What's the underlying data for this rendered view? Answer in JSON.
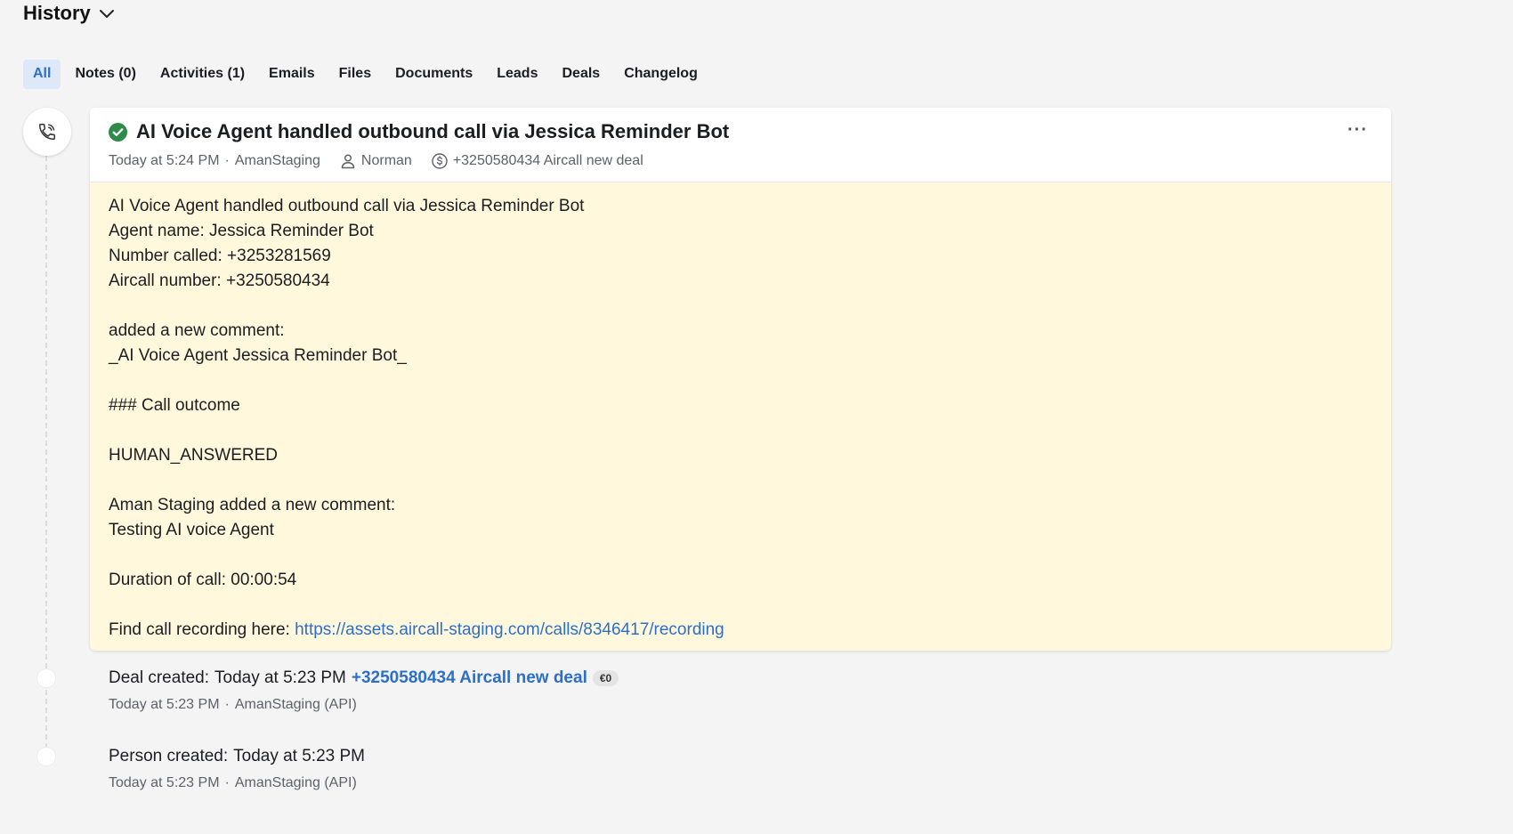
{
  "header": {
    "title": "History"
  },
  "tabs": [
    {
      "label": "All",
      "active": true
    },
    {
      "label": "Notes (0)"
    },
    {
      "label": "Activities (1)"
    },
    {
      "label": "Emails"
    },
    {
      "label": "Files"
    },
    {
      "label": "Documents"
    },
    {
      "label": "Leads"
    },
    {
      "label": "Deals"
    },
    {
      "label": "Changelog"
    }
  ],
  "call_card": {
    "title": "AI Voice Agent handled outbound call via Jessica Reminder Bot",
    "time": "Today at 5:24 PM",
    "author": "AmanStaging",
    "person": "Norman",
    "deal": "+3250580434 Aircall new deal",
    "body_lines": [
      "AI Voice Agent handled outbound call via Jessica Reminder Bot",
      "Agent name: Jessica Reminder Bot",
      "Number called: +3253281569",
      "Aircall number: +3250580434",
      "",
      "added a new comment:",
      "_AI Voice Agent Jessica Reminder Bot_",
      "",
      "### Call outcome",
      "",
      "HUMAN_ANSWERED",
      "",
      "Aman Staging added a new comment:",
      "Testing AI voice Agent",
      "",
      "Duration of call: 00:00:54",
      ""
    ],
    "recording_prefix": "Find call recording here: ",
    "recording_url": "https://assets.aircall-staging.com/calls/8346417/recording"
  },
  "deal_event": {
    "label": "Deal created",
    "time": "Today at 5:23 PM",
    "link": "+3250580434 Aircall new deal",
    "badge": "€0",
    "meta_time": "Today at 5:23 PM",
    "meta_author": "AmanStaging (API)"
  },
  "person_event": {
    "label": "Person created",
    "time": "Today at 5:23 PM",
    "meta_time": "Today at 5:23 PM",
    "meta_author": "AmanStaging (API)"
  },
  "colors": {
    "accent": "#2d6fc7",
    "success": "#2e8b4a",
    "note_bg": "#fff8dc"
  },
  "icons": {
    "header": "chevron-down-icon",
    "call": "phone-icon",
    "status": "check-circle-icon",
    "person": "person-icon",
    "deal": "dollar-circle-icon",
    "more": "more-horizontal-icon"
  }
}
